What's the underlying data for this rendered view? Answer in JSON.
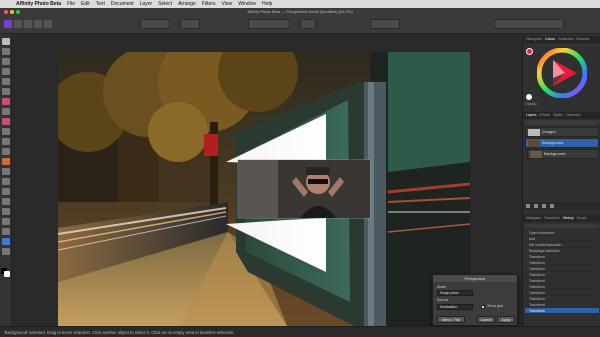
{
  "menubar": {
    "app_name": "Affinity Photo Beta",
    "items": [
      "File",
      "Edit",
      "Text",
      "Document",
      "Layer",
      "Select",
      "Arrange",
      "Filters",
      "View",
      "Window",
      "Help"
    ]
  },
  "window": {
    "title": "Affinity Photo Beta — Perspective Detail (Modified) (53.3%)"
  },
  "panel": {
    "top_tabs": [
      "Histogram",
      "Colour",
      "Swatches",
      "Brushes"
    ],
    "layer_tabs": [
      "Layers",
      "Effects",
      "Styles",
      "Channels"
    ],
    "opacity_label": "Opacity",
    "layers": [
      {
        "name": "(Image)"
      },
      {
        "name": "Background"
      },
      {
        "name": "Background"
      }
    ],
    "history_tabs": [
      "Navigator",
      "Transform",
      "History",
      "Scope"
    ],
    "history": [
      "Open document",
      "Add",
      "Set content selection",
      "Rectangle selection",
      "Transform",
      "Transform",
      "Transform",
      "Transform",
      "Transform",
      "Transform",
      "Transform",
      "Transform",
      "Transform",
      "Transform"
    ]
  },
  "dialog": {
    "title": "Perspective",
    "mode_label": "Mode",
    "mode_value": "Single plane",
    "source_label": "Source",
    "source_value": "Destination",
    "show_grid_label": "Show grid",
    "btn_reset": "Reset",
    "btn_mirror": "Mirror / Flat",
    "btn_cancel": "Cancel",
    "btn_apply": "Apply"
  },
  "status": {
    "text": "'Background' selected. Drag to move selection. Click another object to select it. Click on an empty area to deselect selection."
  },
  "colors": {
    "accent": "#2f62a8",
    "menubar": "#dcdcdc",
    "chrome": "#3a3a3a"
  }
}
